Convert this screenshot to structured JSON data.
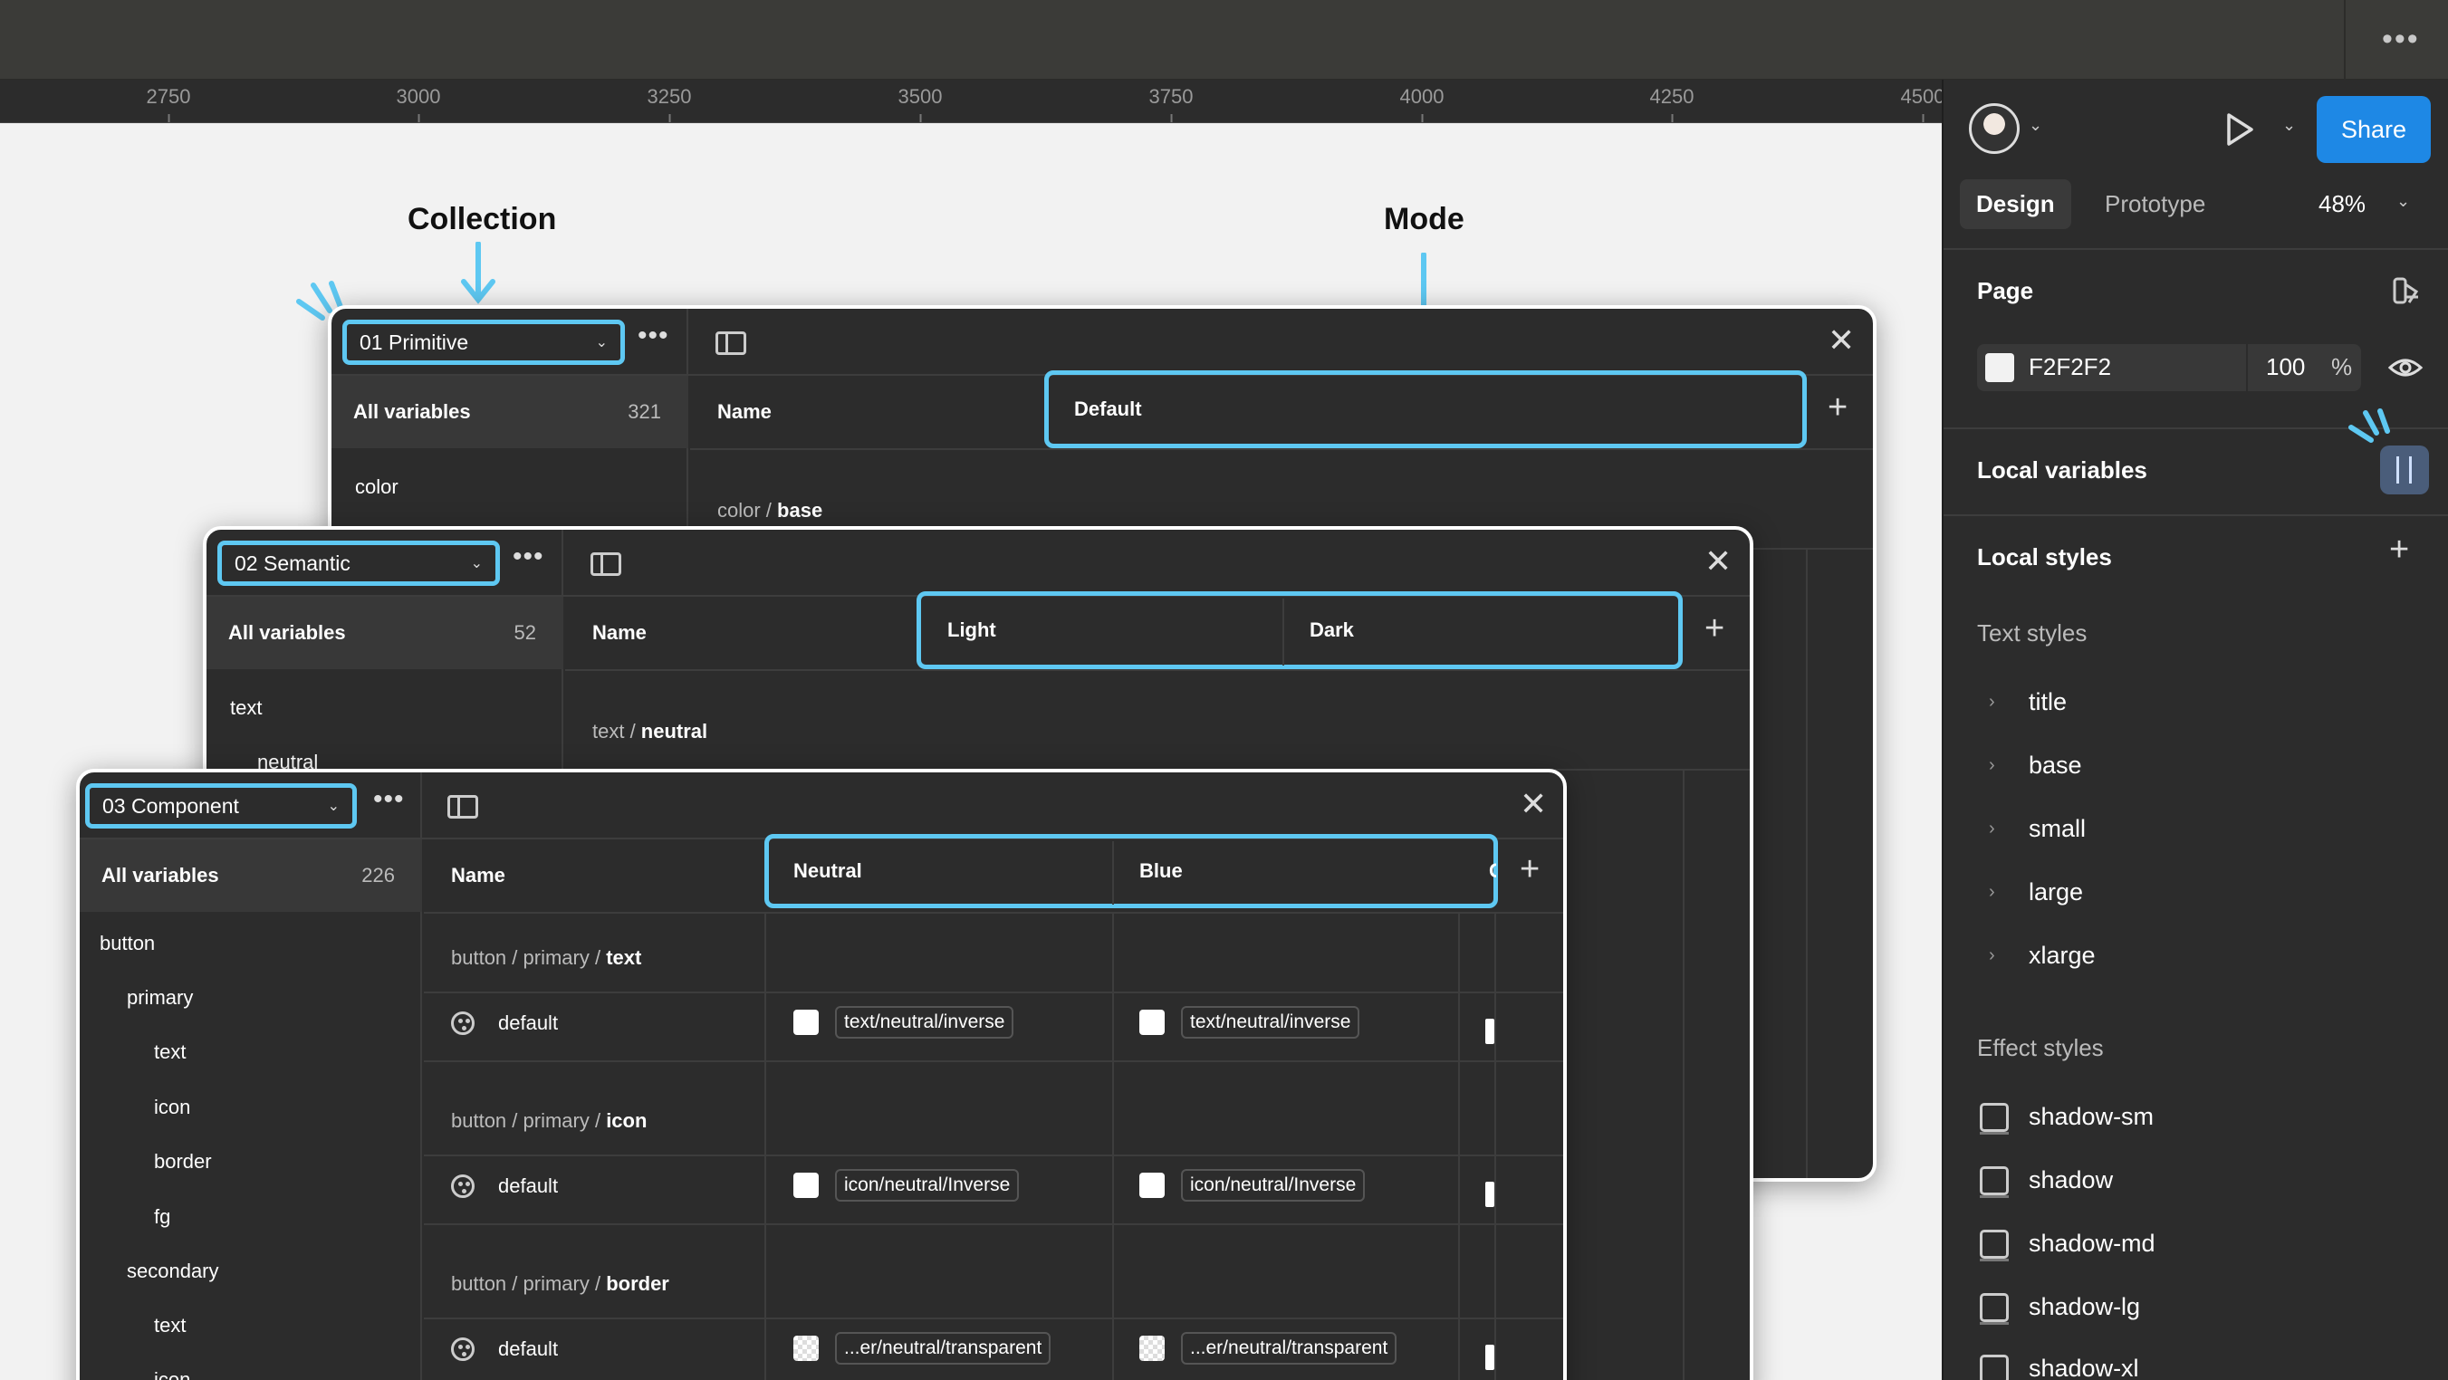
{
  "ruler": {
    "ticks": [
      "2750",
      "3000",
      "3250",
      "3500",
      "3750",
      "4000",
      "4250",
      "4500"
    ]
  },
  "annotations": {
    "collection": "Collection",
    "mode": "Mode"
  },
  "windows": {
    "primitive": {
      "collection": "01 Primitive",
      "all_variables": "All variables",
      "count": "321",
      "tree": [
        "color"
      ],
      "col_name": "Name",
      "modes": [
        "Default"
      ],
      "group": {
        "prefix": "color / ",
        "bold": "base"
      }
    },
    "semantic": {
      "collection": "02 Semantic",
      "all_variables": "All variables",
      "count": "52",
      "tree": [
        "text",
        "neutral"
      ],
      "col_name": "Name",
      "modes": [
        "Light",
        "Dark"
      ],
      "group": {
        "prefix": "text / ",
        "bold": "neutral"
      },
      "partial_value": "%"
    },
    "component": {
      "collection": "03 Component",
      "all_variables": "All variables",
      "count": "226",
      "tree": [
        "button",
        "primary",
        "text",
        "icon",
        "border",
        "fg",
        "secondary",
        "text",
        "icon"
      ],
      "col_name": "Name",
      "modes": [
        "Neutral",
        "Blue"
      ],
      "partial_mode": "C",
      "groups": [
        {
          "prefix": "button / primary / ",
          "bold": "text",
          "var": "default",
          "neutral": "text/neutral/inverse",
          "blue": "text/neutral/inverse"
        },
        {
          "prefix": "button / primary / ",
          "bold": "icon",
          "var": "default",
          "neutral": "icon/neutral/Inverse",
          "blue": "icon/neutral/Inverse"
        },
        {
          "prefix": "button / primary / ",
          "bold": "border",
          "var": "default",
          "neutral": "...er/neutral/transparent",
          "blue": "...er/neutral/transparent"
        }
      ]
    }
  },
  "right_panel": {
    "share": "Share",
    "tabs": {
      "design": "Design",
      "prototype": "Prototype"
    },
    "zoom": "48%",
    "page": {
      "title": "Page",
      "color": "F2F2F2",
      "opacity": "100",
      "percent": "%"
    },
    "local_variables": "Local variables",
    "local_styles": "Local styles",
    "text_styles": {
      "title": "Text styles",
      "items": [
        "title",
        "base",
        "small",
        "large",
        "xlarge"
      ]
    },
    "effect_styles": {
      "title": "Effect styles",
      "items": [
        "shadow-sm",
        "shadow",
        "shadow-md",
        "shadow-lg",
        "shadow-xl"
      ]
    }
  },
  "colors": {
    "highlight": "#5ec8f2",
    "share": "#1e88e5",
    "panel": "#2c2c2c",
    "canvas": "#f2f2f2"
  }
}
